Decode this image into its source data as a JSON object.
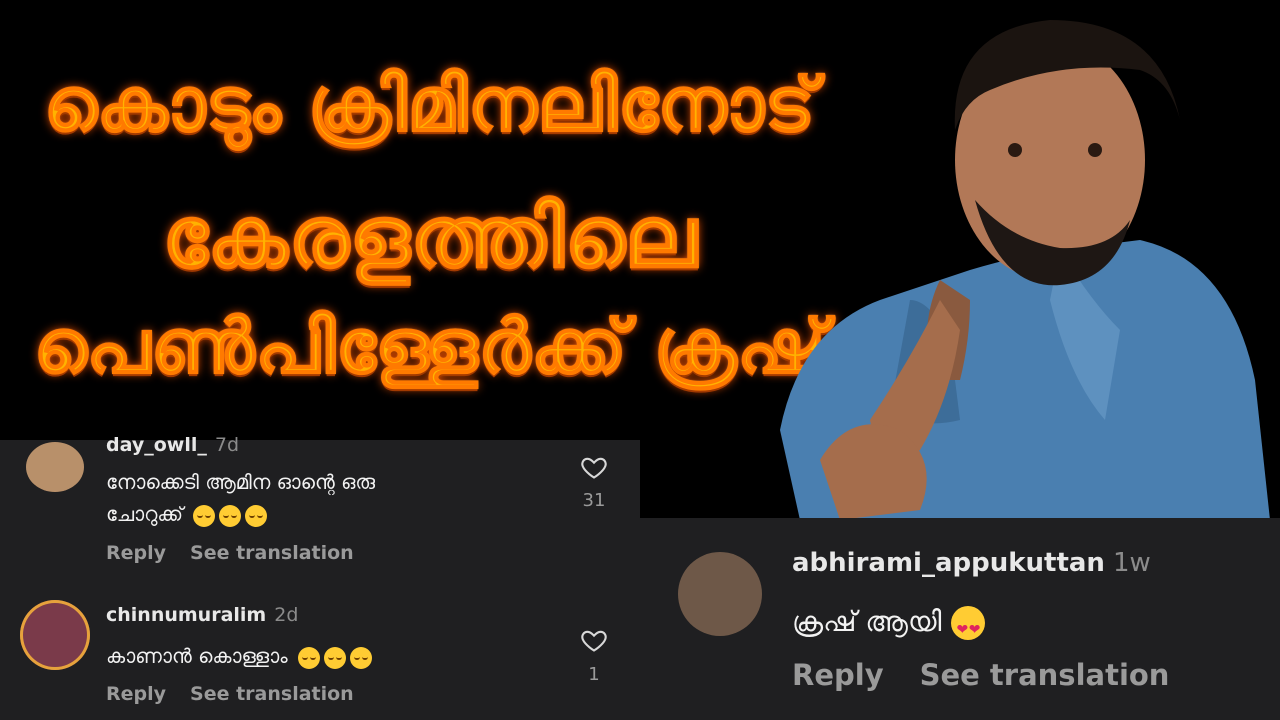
{
  "headline": {
    "line1": "കൊടും ക്രിമിനലിനോട്",
    "line2": "കേരളത്തിലെ",
    "line3": "പെൺപിള്ളേർക്ക് ക്രഷ്"
  },
  "comments_left": [
    {
      "username": "day_owll_",
      "time": "7d",
      "text_line1": "നോക്കെടി ആമിന ഓന്റെ ഒരു",
      "text_line2": "ചോറുക്ക്",
      "likes": "31",
      "reply": "Reply",
      "see_translation": "See translation"
    },
    {
      "username": "chinnumuralim",
      "time": "2d",
      "text_line1": "കാണാൻ കൊള്ളാം",
      "likes": "1",
      "reply": "Reply",
      "see_translation": "See translation"
    }
  ],
  "comment_right": {
    "username": "abhirami_appukuttan",
    "time": "1w",
    "text": "ക്രഷ് ആയി",
    "reply": "Reply",
    "see_translation": "See translation"
  },
  "colors": {
    "headline": "#ffb300",
    "panel_bg": "#1f1f21",
    "shirt": "#4a7fb0"
  },
  "icons": [
    "heart-outline-icon",
    "relieved-face-emoji",
    "heart-eyes-emoji"
  ]
}
